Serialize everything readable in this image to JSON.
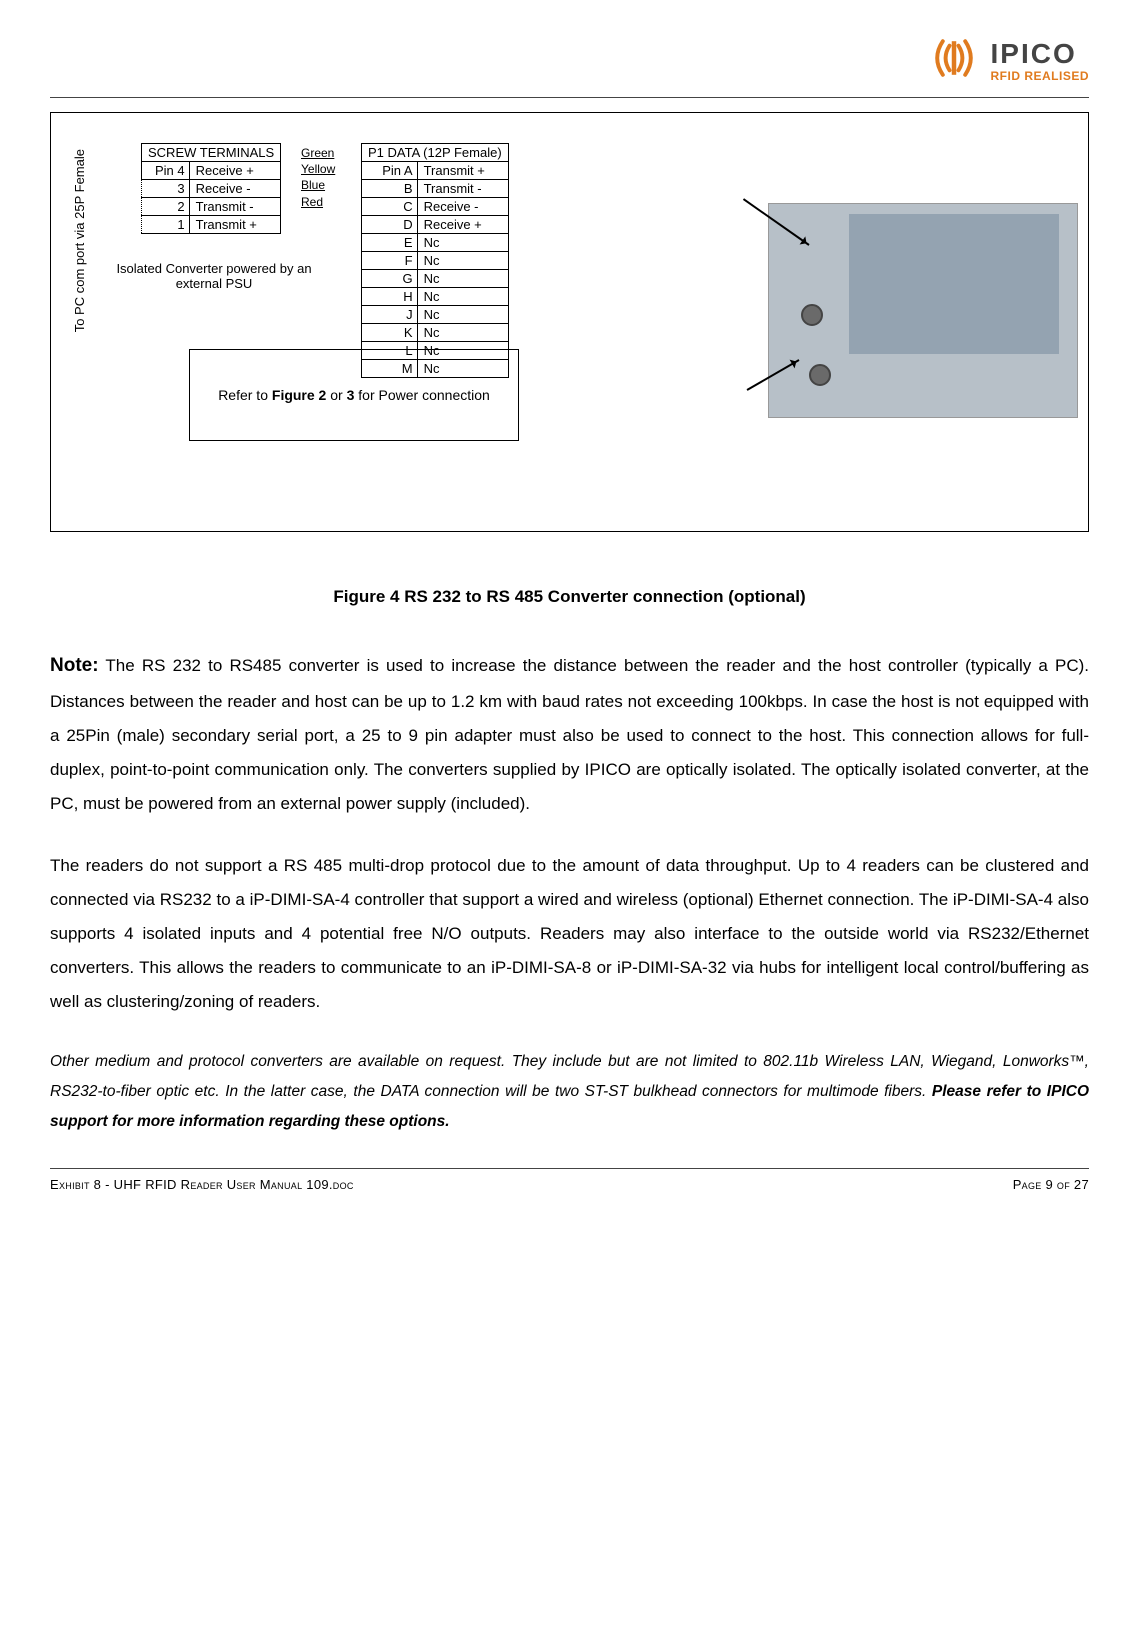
{
  "logo": {
    "name": "IPICO",
    "tagline": "RFID REALISED"
  },
  "side_label": "To PC com port via 25P Female",
  "screw_table": {
    "header": "SCREW TERMINALS",
    "rows": [
      {
        "pin": "Pin 4",
        "signal": "Receive +"
      },
      {
        "pin": "3",
        "signal": "Receive -"
      },
      {
        "pin": "2",
        "signal": "Transmit -"
      },
      {
        "pin": "1",
        "signal": "Transmit +"
      }
    ]
  },
  "wires": [
    "Green",
    "Yellow",
    "Blue",
    "Red"
  ],
  "p1_table": {
    "header": "P1 DATA (12P Female)",
    "rows": [
      {
        "pin": "Pin A",
        "signal": "Transmit +"
      },
      {
        "pin": "B",
        "signal": "Transmit -"
      },
      {
        "pin": "C",
        "signal": "Receive -"
      },
      {
        "pin": "D",
        "signal": "Receive +"
      },
      {
        "pin": "E",
        "signal": "Nc"
      },
      {
        "pin": "F",
        "signal": "Nc"
      },
      {
        "pin": "G",
        "signal": "Nc"
      },
      {
        "pin": "H",
        "signal": "Nc"
      },
      {
        "pin": "J",
        "signal": "Nc"
      },
      {
        "pin": "K",
        "signal": "Nc"
      },
      {
        "pin": "L",
        "signal": "Nc"
      },
      {
        "pin": "M",
        "signal": "Nc"
      }
    ]
  },
  "psu_caption": "Isolated Converter powered by an external PSU",
  "power_box_pre": "Refer to ",
  "power_box_b1": "Figure 2",
  "power_box_mid": " or ",
  "power_box_b2": "3",
  "power_box_post": " for Power connection",
  "figure_caption": "Figure 4 RS 232 to RS 485 Converter connection (optional)",
  "note_label": "Note:",
  "para1": " The RS 232 to RS485 converter is used to increase the distance between the reader and the host controller (typically a PC). Distances between the reader and host can be up to 1.2 km with baud rates not exceeding 100kbps. In case the host is not equipped with a 25Pin (male) secondary serial port, a 25 to 9 pin adapter must also be used to connect to the host. This connection allows for full-duplex, point-to-point communication only. The converters supplied by IPICO are optically isolated. The optically isolated converter, at the PC, must be powered from an external power supply (included).",
  "para2": "The readers do not support a RS 485 multi-drop protocol due to the amount of data throughput. Up to 4 readers can be clustered and connected via RS232 to a iP-DIMI-SA-4 controller that support a wired and wireless (optional) Ethernet connection. The iP-DIMI-SA-4 also supports 4 isolated inputs and 4 potential free N/O outputs. Readers may also interface to the outside world via RS232/Ethernet converters. This allows the readers to communicate to an iP-DIMI-SA-8 or iP-DIMI-SA-32 via hubs for intelligent local control/buffering as well as clustering/zoning of readers.",
  "para3_pre": "Other medium and protocol converters are available on request. They include but are not limited to 802.11b Wireless LAN, Wiegand, Lonworks™, RS232-to-fiber optic etc. In the latter case, the DATA connection will be two ST-ST bulkhead connectors for multimode fibers. ",
  "para3_bold": "Please refer to IPICO support for more information regarding these options.",
  "footer_left": "Exhibit 8 - UHF RFID Reader User Manual 109.doc",
  "footer_right": "Page 9 of 27"
}
